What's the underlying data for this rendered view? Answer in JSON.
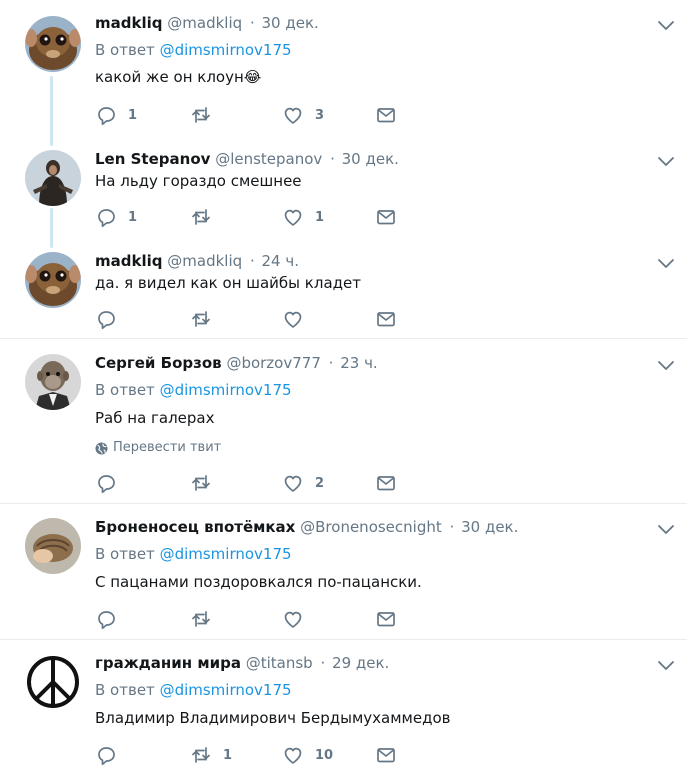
{
  "colors": {
    "link": "#1b95e0",
    "muted": "#657786",
    "text": "#14171a",
    "thread_line": "#cce6f4",
    "separator": "#e6ecf0"
  },
  "labels": {
    "reply_prefix": "В ответ",
    "dot": "·"
  },
  "tweets": [
    {
      "name": "madkliq",
      "handle": "@madkliq",
      "time": "30 дек.",
      "reply_to": "@dimsmirnov175",
      "text": "какой же он клоун",
      "emoji": "😂",
      "replies": "1",
      "retweets": "",
      "likes": "3"
    },
    {
      "name": "Len Stepanov",
      "handle": "@lenstepanov",
      "time": "30 дек.",
      "text": "На льду гораздо смешнее",
      "replies": "1",
      "retweets": "",
      "likes": "1"
    },
    {
      "name": "madkliq",
      "handle": "@madkliq",
      "time": "24 ч.",
      "text": "да. я видел как он шайбы кладет",
      "replies": "",
      "retweets": "",
      "likes": ""
    },
    {
      "name": "Сергей Борзов",
      "handle": "@borzov777",
      "time": "23 ч.",
      "reply_to": "@dimsmirnov175",
      "text": "Раб на галерах",
      "translate": "Перевести твит",
      "replies": "",
      "retweets": "",
      "likes": "2"
    },
    {
      "name": "Броненосец впотёмках",
      "handle": "@Bronenosecnight",
      "time": "30 дек.",
      "reply_to": "@dimsmirnov175",
      "text": "С пацанами поздоровкался по-пацански.",
      "replies": "",
      "retweets": "",
      "likes": ""
    },
    {
      "name": "гражданин мира",
      "handle": "@titansb",
      "time": "29 дек.",
      "reply_to": "@dimsmirnov175",
      "text": "Владимир Владимирович Бердымухаммедов",
      "replies": "",
      "retweets": "1",
      "likes": "10"
    }
  ]
}
